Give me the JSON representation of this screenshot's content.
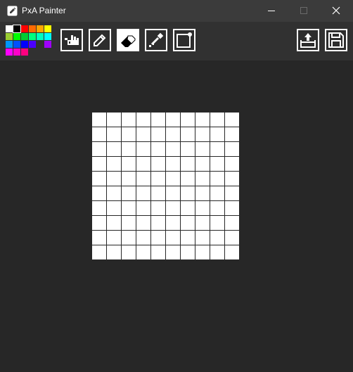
{
  "window": {
    "title": "PxA Painter",
    "controls": {
      "minimize": "minimize",
      "maximize": "maximize",
      "close": "close"
    }
  },
  "palette": {
    "selected_index": 1,
    "colors": [
      "#ffffff",
      "#000000",
      "#ff0000",
      "#ff6a00",
      "#ffa500",
      "#ffff00",
      "#9acd32",
      "#00ff00",
      "#00cc33",
      "#00ff80",
      "#00ffc0",
      "#00ffff",
      "#0096ff",
      "#0050ff",
      "#0000ff",
      "#4b00ff",
      "#313131",
      "#a000ff",
      "#ff00ff",
      "#ff00c8",
      "#ff0080"
    ]
  },
  "tools": [
    {
      "name": "fill-tool",
      "icon": "bucket-fill-icon"
    },
    {
      "name": "pencil-tool",
      "icon": "pencil-icon"
    },
    {
      "name": "eraser-tool",
      "icon": "eraser-icon"
    },
    {
      "name": "eyedropper-tool",
      "icon": "eyedropper-icon"
    },
    {
      "name": "new-canvas-tool",
      "icon": "new-canvas-icon"
    }
  ],
  "actions": [
    {
      "name": "export",
      "icon": "export-icon"
    },
    {
      "name": "save",
      "icon": "save-icon"
    }
  ],
  "canvas": {
    "rows": 10,
    "cols": 10,
    "cell_color": "#ffffff",
    "grid_color": "#272727"
  }
}
